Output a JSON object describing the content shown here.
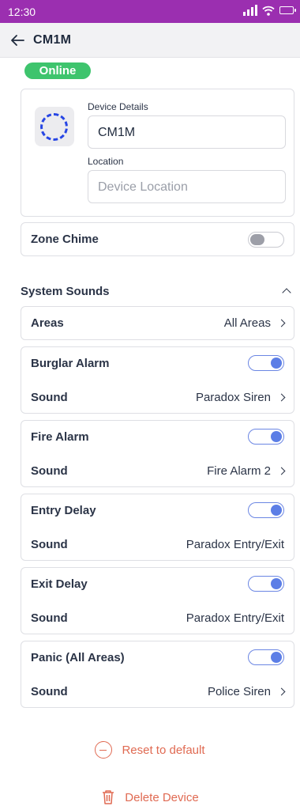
{
  "status_bar": {
    "time": "12:30"
  },
  "header": {
    "title": "CM1M"
  },
  "status_badge": "Online",
  "device": {
    "details_label": "Device Details",
    "name_value": "CM1M",
    "location_label": "Location",
    "location_placeholder": "Device Location"
  },
  "zone_chime": {
    "label": "Zone Chime",
    "enabled": false
  },
  "system_sounds": {
    "title": "System Sounds",
    "areas": {
      "label": "Areas",
      "value": "All Areas"
    },
    "burglar": {
      "label": "Burglar Alarm",
      "enabled": true,
      "sound_label": "Sound",
      "sound_value": "Paradox Siren"
    },
    "fire": {
      "label": "Fire Alarm",
      "enabled": true,
      "sound_label": "Sound",
      "sound_value": "Fire Alarm 2"
    },
    "entry": {
      "label": "Entry Delay",
      "enabled": true,
      "sound_label": "Sound",
      "sound_value": "Paradox Entry/Exit"
    },
    "exit": {
      "label": "Exit Delay",
      "enabled": true,
      "sound_label": "Sound",
      "sound_value": "Paradox Entry/Exit"
    },
    "panic": {
      "label": "Panic (All Areas)",
      "enabled": true,
      "sound_label": "Sound",
      "sound_value": "Police Siren"
    }
  },
  "actions": {
    "reset": "Reset to default",
    "delete": "Delete Device"
  },
  "colors": {
    "status_bar": "#9b2fb0",
    "online": "#3ec46d",
    "toggle_on": "#5c7ee6",
    "danger": "#e06a52"
  },
  "icons": [
    "signal-icon",
    "wifi-icon",
    "battery-icon",
    "back-arrow-icon",
    "device-icon",
    "chevron-right-icon",
    "chevron-up-icon",
    "minus-circle-icon",
    "trash-icon"
  ]
}
